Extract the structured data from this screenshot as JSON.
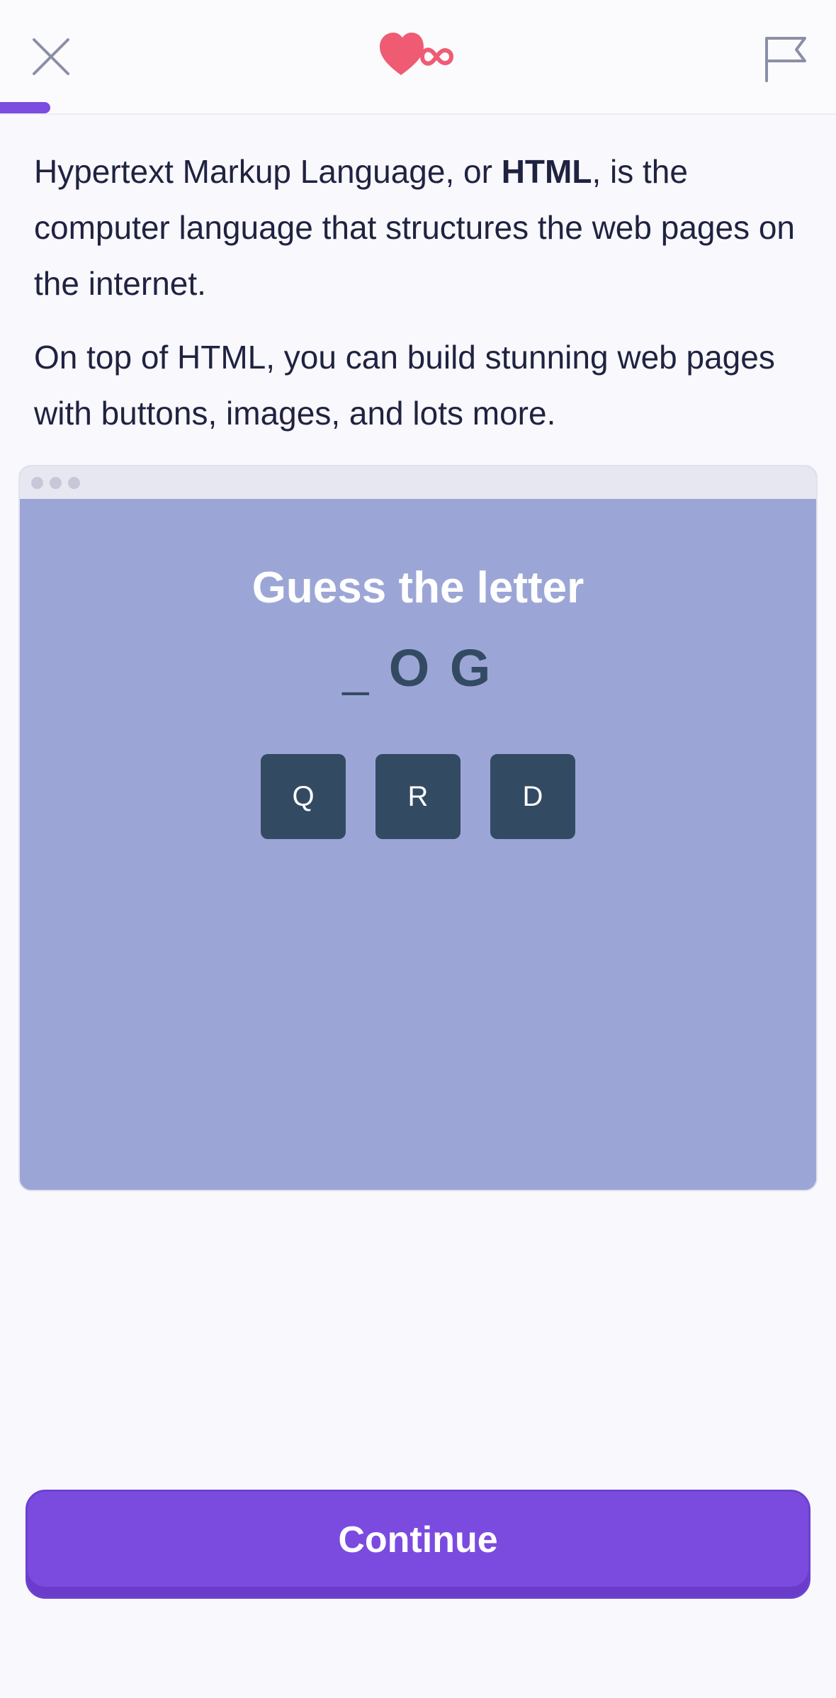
{
  "header": {
    "close_icon": "close-icon",
    "lives_icon": "heart-infinity-icon",
    "flag_icon": "flag-icon",
    "progress_fraction": 0.06,
    "accent_color": "#7c4ddf",
    "heart_color": "#ef5b73"
  },
  "lesson": {
    "paragraph1_before": "Hypertext Markup Language, or ",
    "paragraph1_bold": "HTML",
    "paragraph1_after": ", is the computer language that structures the web pages on the internet.",
    "paragraph2": "On top of HTML, you can build stunning web pages with buttons, images, and lots more."
  },
  "preview": {
    "title": "Guess the letter",
    "word_blank": "_",
    "word_letters": "O G",
    "options": [
      "Q",
      "R",
      "D"
    ],
    "background_color": "#9ca6d6",
    "button_color": "#334a63"
  },
  "footer": {
    "continue_label": "Continue"
  }
}
